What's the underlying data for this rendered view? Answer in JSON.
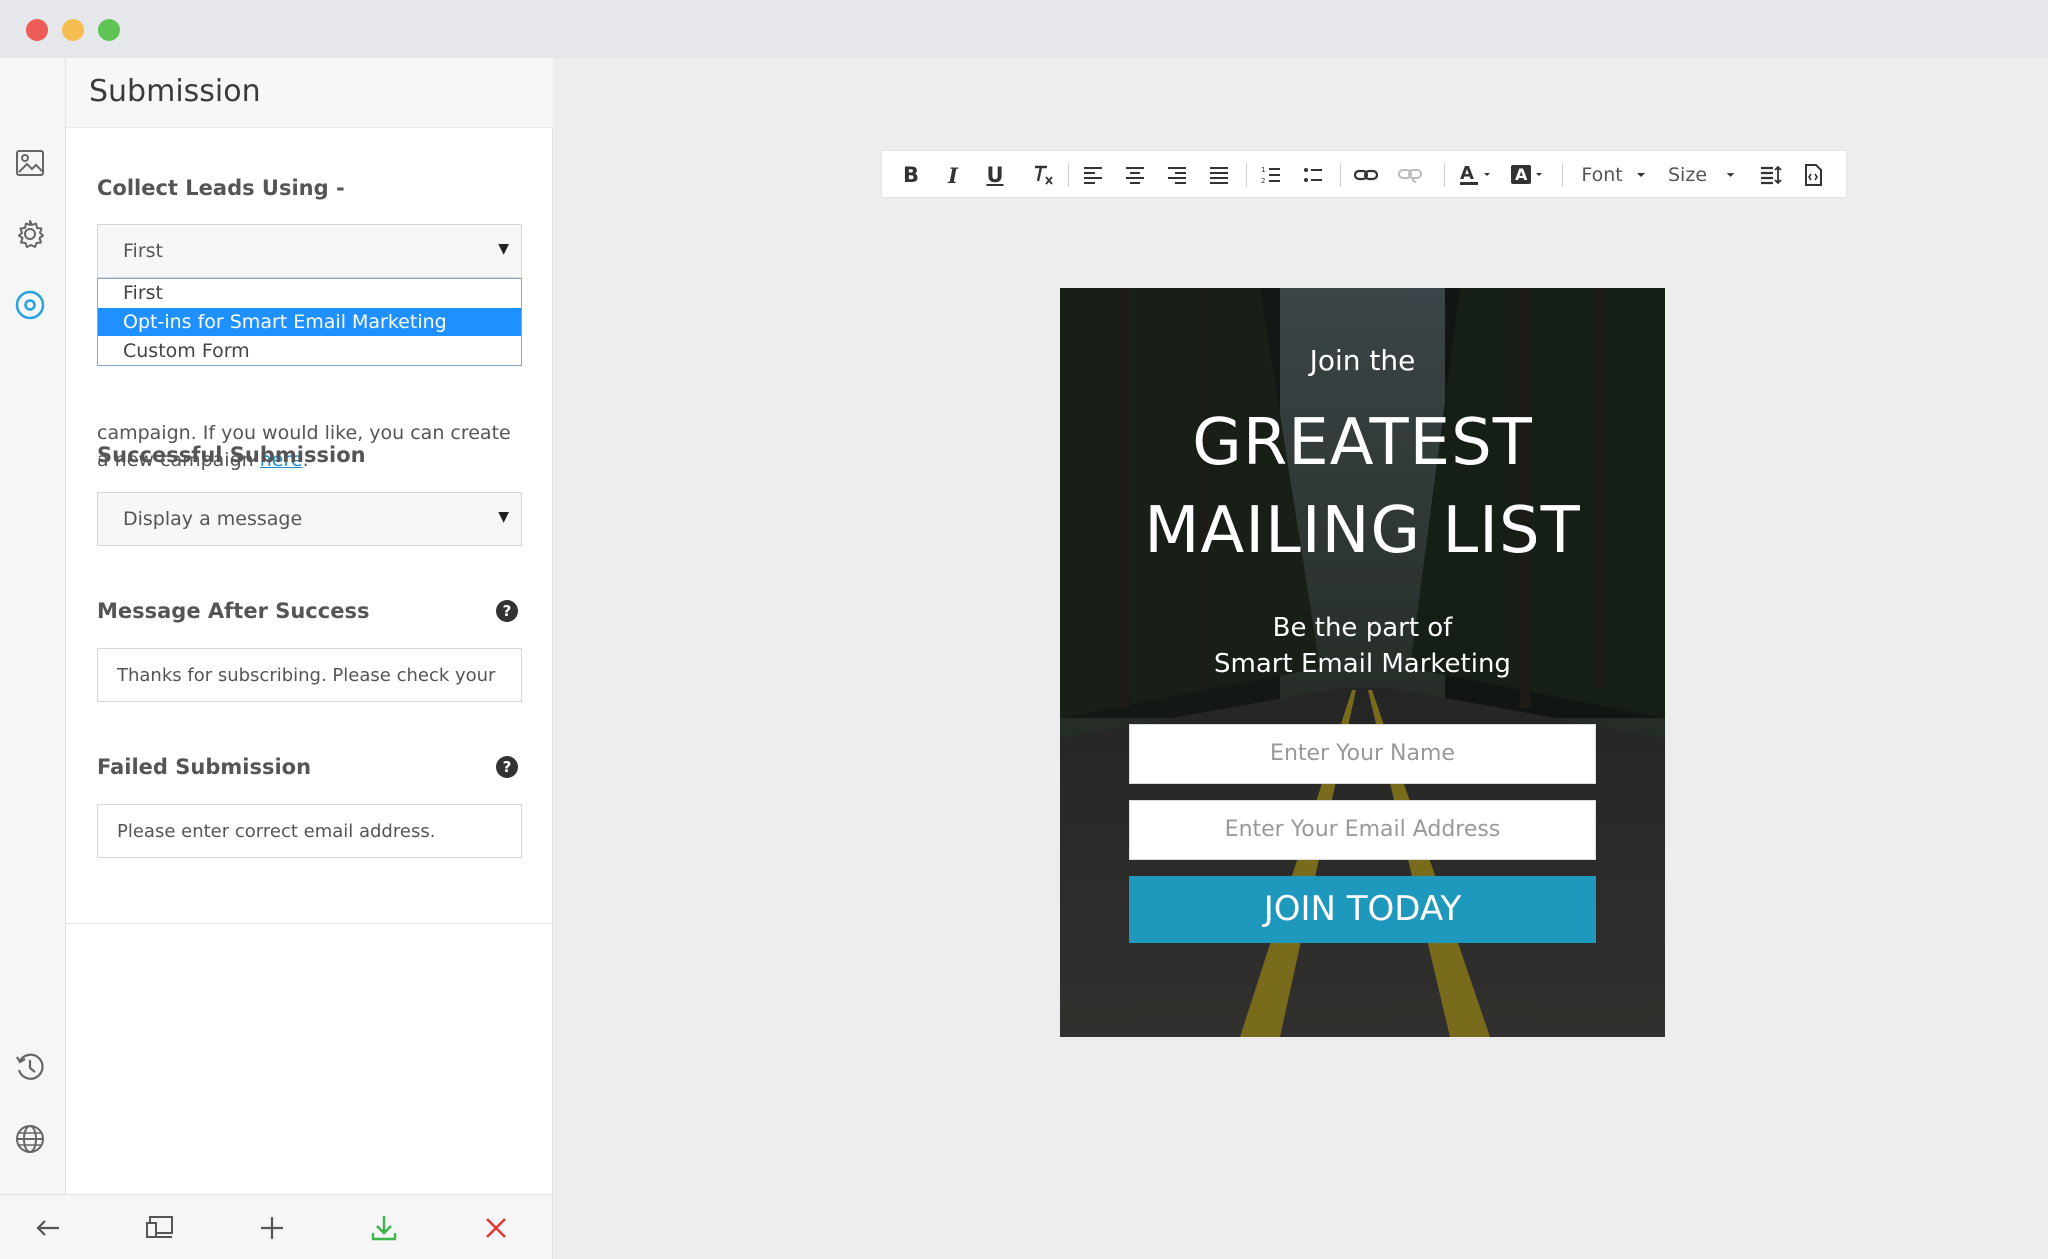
{
  "panel": {
    "title": "Submission",
    "collect_label": "Collect Leads Using -",
    "collect_value": "First",
    "dropdown_options": [
      "First",
      "Opt-ins for Smart Email Marketing",
      "Custom Form"
    ],
    "dropdown_selected": "Opt-ins for Smart Email Marketing",
    "help_text_prefix": "campaign. If you would like, you can create a new campaign",
    "help_text_link": "here",
    "help_text_suffix": ".",
    "success_label": "Successful Submission",
    "success_value": "Display a message",
    "message_label": "Message After Success",
    "message_value": "Thanks for subscribing. Please check your",
    "failed_label": "Failed Submission",
    "failed_value": "Please enter correct email address.",
    "help_glyph": "?"
  },
  "toolbar": {
    "bold": "B",
    "italic": "I",
    "underline": "U",
    "font_label": "Font",
    "size_label": "Size"
  },
  "preview": {
    "join": "Join the",
    "headline1": "GREATEST",
    "headline2": "MAILING LIST",
    "sub1": "Be the part of",
    "sub2": "Smart Email Marketing",
    "name_placeholder": "Enter Your Name",
    "email_placeholder": "Enter Your Email Address",
    "button": "JOIN TODAY"
  },
  "colors": {
    "accent": "#1e90ff",
    "join_button": "#1f98bd",
    "save": "#3cb44a",
    "close": "#e53935",
    "active_rail": "#29a3e0"
  },
  "icons": [
    "image-icon",
    "gear-icon",
    "target-icon",
    "history-icon",
    "globe-icon",
    "back-arrow-icon",
    "devices-icon",
    "plus-icon",
    "download-icon",
    "close-icon"
  ]
}
